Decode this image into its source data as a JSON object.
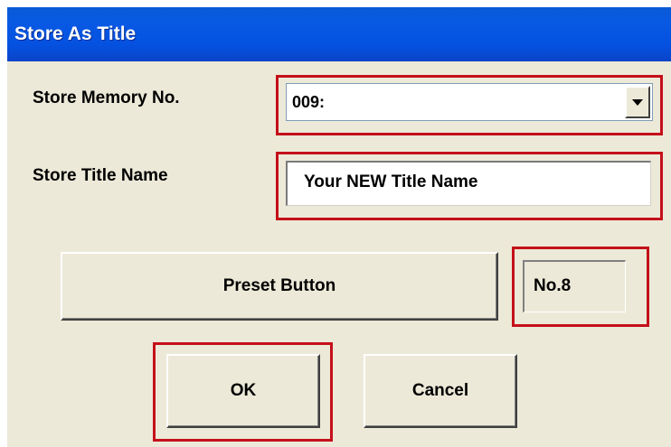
{
  "dialog": {
    "title": "Store As Title"
  },
  "memory": {
    "label": "Store Memory No.",
    "value": "009:"
  },
  "title_name": {
    "label": "Store Title Name",
    "value": "Your NEW Title Name"
  },
  "preset": {
    "button_label": "Preset Button",
    "number": "No.8"
  },
  "actions": {
    "ok_label": "OK",
    "cancel_label": "Cancel"
  },
  "colors": {
    "titlebar": "#0551e0",
    "dialog_bg": "#ece9d8",
    "highlight": "#c4101a"
  }
}
